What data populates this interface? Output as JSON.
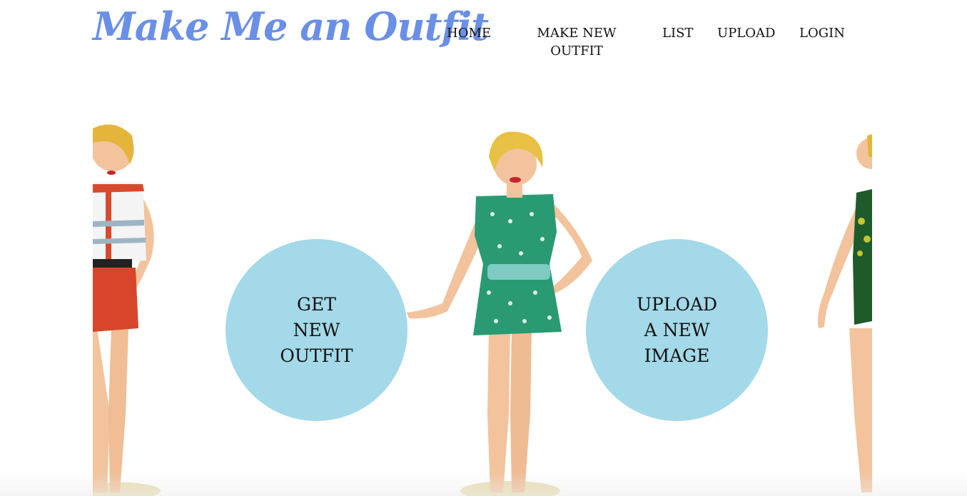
{
  "header": {
    "logo_text": "Make Me an Outfit",
    "nav": {
      "home": "HOME",
      "make_new_outfit": "MAKE NEW OUTFIT",
      "list": "LIST",
      "upload": "UPLOAD",
      "login": "LOGIN"
    }
  },
  "hero": {
    "get_new_outfit": "GET\nNEW\nOUTFIT",
    "upload_new_image": "UPLOAD\nA NEW\nIMAGE",
    "images": [
      "paper-doll-red-shorts",
      "paper-doll-green-romper",
      "paper-doll-swimsuit"
    ]
  },
  "colors": {
    "logo": "#6a8fe6",
    "circle": "#a3d9e8",
    "text": "#111111"
  }
}
